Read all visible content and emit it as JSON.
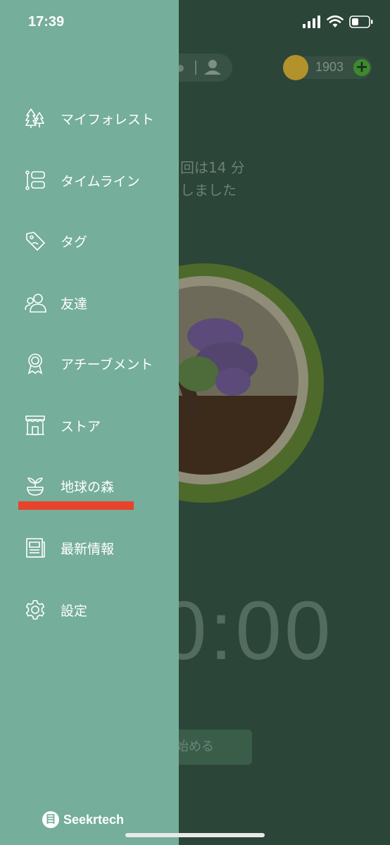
{
  "status_bar": {
    "time": "17:39"
  },
  "background": {
    "coins": "1903",
    "message_line1": "回は14 分",
    "message_line2": "しました",
    "timer": "0:00",
    "start_button": "始める"
  },
  "drawer": {
    "items": [
      {
        "label": "マイフォレスト",
        "icon": "trees-icon"
      },
      {
        "label": "タイムライン",
        "icon": "timeline-icon"
      },
      {
        "label": "タグ",
        "icon": "tag-icon"
      },
      {
        "label": "友達",
        "icon": "friends-icon"
      },
      {
        "label": "アチーブメント",
        "icon": "achievement-icon"
      },
      {
        "label": "ストア",
        "icon": "store-icon"
      },
      {
        "label": "地球の森",
        "icon": "sprout-icon"
      },
      {
        "label": "最新情報",
        "icon": "news-icon"
      },
      {
        "label": "設定",
        "icon": "gear-icon"
      }
    ]
  },
  "watermark": {
    "badge": "目",
    "text": "Seekrtech"
  },
  "colors": {
    "drawer": "#75ae9a",
    "background": "#2b4538",
    "highlight": "#e8432c"
  }
}
